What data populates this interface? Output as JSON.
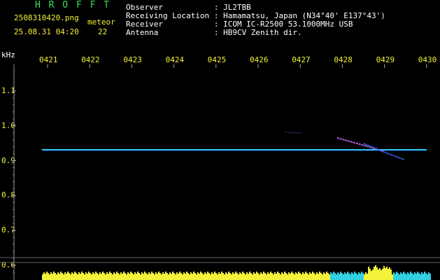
{
  "header": {
    "logo": "H R O F F T",
    "filename": "2508310420.png",
    "datetime": "25.08.31 04:20",
    "meteor_label": "meteor",
    "meteor_count": "22"
  },
  "station": {
    "observer": "Observer           : JL2TBB",
    "location": "Receiving Location : Hamamatsu, Japan (N34°40' E137°43')",
    "receiver": "Receiver           : ICOM IC-R2500 53.1000MHz USB",
    "antenna": "Antenna            : HB9CV Zenith dir."
  },
  "colors": {
    "logo": "#3fdc5a",
    "time_labels": "#f2f23a",
    "freq_labels": "#f2f23a",
    "text": "#ffffff",
    "trace": "#36e0e8",
    "meteor": "#c060e0",
    "noise_floor": "#f2f23a"
  },
  "axis": {
    "unit": "kHz",
    "time_ticks": [
      "0421",
      "0422",
      "0423",
      "0424",
      "0425",
      "0426",
      "0427",
      "0428",
      "0429",
      "0430"
    ],
    "freq_ticks": [
      "1.1",
      "1.0",
      "0.9",
      "0.8",
      "0.7",
      "0.6"
    ]
  }
}
